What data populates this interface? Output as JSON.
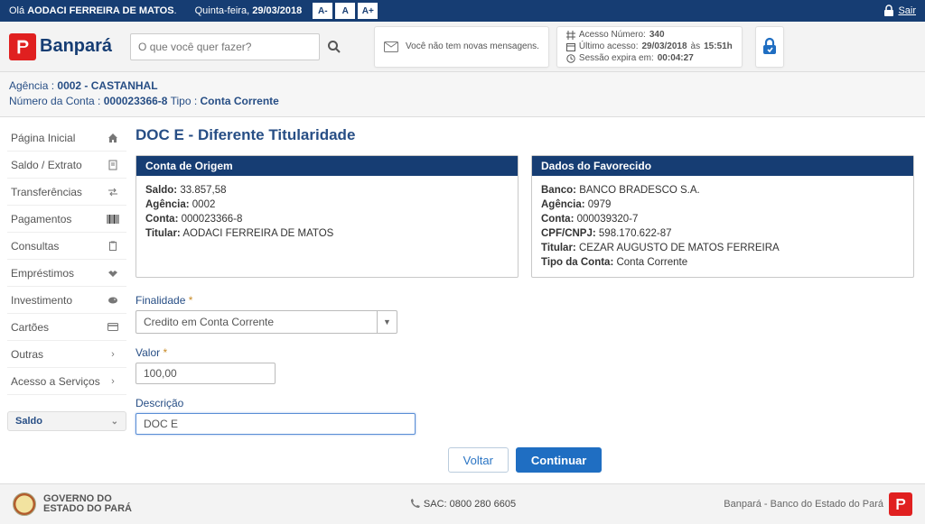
{
  "topbar": {
    "greeting_prefix": "Olá",
    "user": "AODACI FERREIRA DE MATOS",
    "weekday": "Quinta-feira,",
    "date": "29/03/2018",
    "font_dec": "A-",
    "font_norm": "A",
    "font_inc": "A+",
    "logout": "Sair"
  },
  "header": {
    "brand": "Banpará",
    "search_placeholder": "O que você quer fazer?",
    "no_messages": "Você não tem novas mensagens.",
    "info": {
      "access_num_label": "Acesso Número:",
      "access_num": "340",
      "last_access_label": "Último acesso:",
      "last_access_date": "29/03/2018",
      "last_access_sep": "às",
      "last_access_time": "15:51h",
      "session_label": "Sessão expira em:",
      "session_time": "00:04:27"
    }
  },
  "account_strip": {
    "agencia_label": "Agência :",
    "agencia_value": "0002 - CASTANHAL",
    "conta_label": "Número da Conta :",
    "conta_value": "000023366-8",
    "tipo_label": "Tipo :",
    "tipo_value": "Conta Corrente"
  },
  "sidebar": {
    "items": [
      {
        "label": "Página Inicial",
        "icon": "home-icon"
      },
      {
        "label": "Saldo / Extrato",
        "icon": "document-icon"
      },
      {
        "label": "Transferências",
        "icon": "transfer-icon"
      },
      {
        "label": "Pagamentos",
        "icon": "barcode-icon"
      },
      {
        "label": "Consultas",
        "icon": "clipboard-icon"
      },
      {
        "label": "Empréstimos",
        "icon": "handshake-icon"
      },
      {
        "label": "Investimento",
        "icon": "piggy-icon"
      },
      {
        "label": "Cartões",
        "icon": "card-icon"
      },
      {
        "label": "Outras",
        "icon": "chevron-right-icon"
      },
      {
        "label": "Acesso a Serviços",
        "icon": "chevron-right-icon"
      }
    ],
    "saldo_toggle": "Saldo"
  },
  "page": {
    "title": "DOC E - Diferente Titularidade",
    "origin": {
      "header": "Conta de Origem",
      "saldo_label": "Saldo:",
      "saldo": "33.857,58",
      "agencia_label": "Agência:",
      "agencia": "0002",
      "conta_label": "Conta:",
      "conta": "000023366-8",
      "titular_label": "Titular:",
      "titular": "AODACI FERREIRA DE MATOS"
    },
    "fav": {
      "header": "Dados do Favorecido",
      "banco_label": "Banco:",
      "banco": "BANCO BRADESCO S.A.",
      "agencia_label": "Agência:",
      "agencia": "0979",
      "conta_label": "Conta:",
      "conta": "000039320-7",
      "cpf_label": "CPF/CNPJ:",
      "cpf": "598.170.622-87",
      "titular_label": "Titular:",
      "titular": "CEZAR AUGUSTO DE MATOS FERREIRA",
      "tipo_label": "Tipo da Conta:",
      "tipo": "Conta Corrente"
    },
    "form": {
      "finalidade_label": "Finalidade",
      "finalidade_value": "Credito em Conta Corrente",
      "valor_label": "Valor",
      "valor_value": "100,00",
      "descricao_label": "Descrição",
      "descricao_value": "DOC E"
    },
    "buttons": {
      "back": "Voltar",
      "continue": "Continuar"
    }
  },
  "footer": {
    "gov_line1": "GOVERNO DO",
    "gov_line2": "ESTADO DO PARÁ",
    "sac": "SAC: 0800 280 6605",
    "brand_full": "Banpará - Banco do Estado do Pará"
  }
}
